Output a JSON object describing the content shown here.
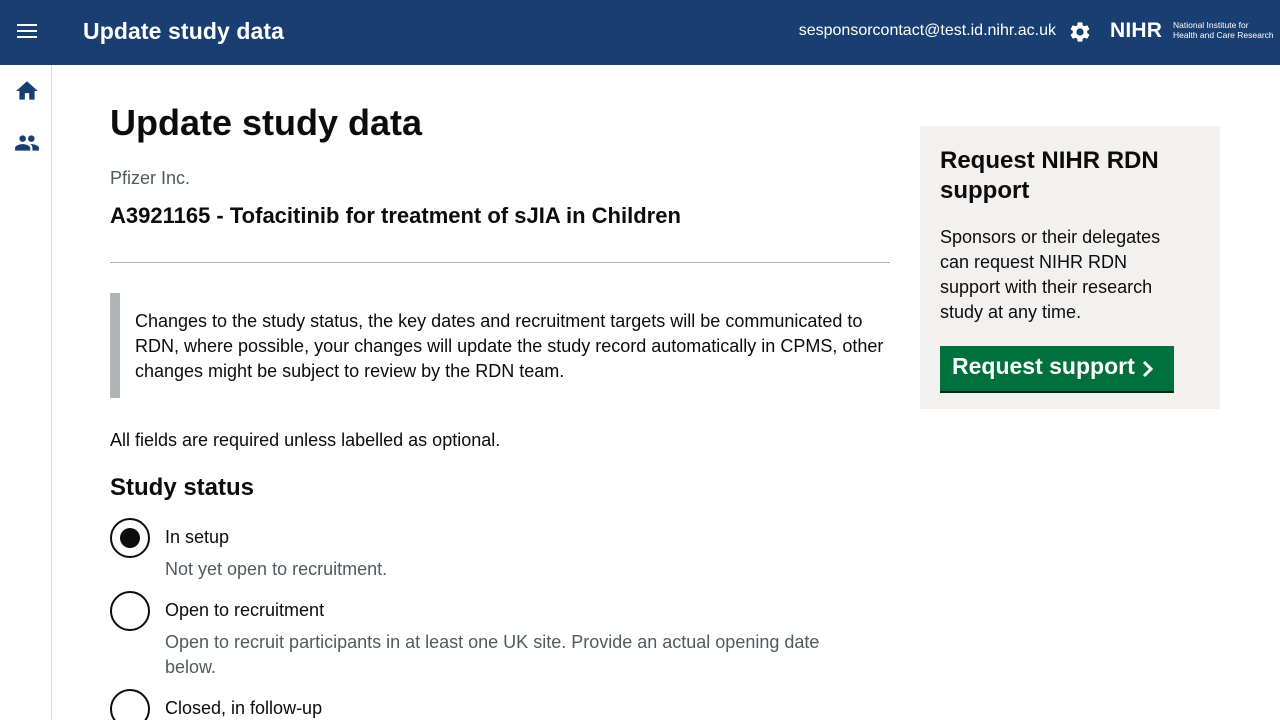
{
  "header": {
    "app_title": "Update study data",
    "user_email": "sesponsorcontact@test.id.nihr.ac.uk",
    "logo_main": "NIHR",
    "logo_sub_line1": "National Institute for",
    "logo_sub_line2": "Health and Care Research",
    "icons": [
      "menu-icon",
      "gear-icon"
    ]
  },
  "siderail": {
    "icons": [
      "home-icon",
      "people-icon"
    ]
  },
  "main": {
    "page_title": "Update study data",
    "organisation": "Pfizer Inc.",
    "study_title": "A3921165 - Tofacitinib for treatment of sJIA in Children",
    "inset_text": "Changes to the study status, the key dates and recruitment targets will be communicated to RDN, where possible, your changes will update the study record automatically in CPMS, other changes might be subject to review by the RDN team.",
    "required_note": "All fields are required unless labelled as optional.",
    "study_status": {
      "heading": "Study status",
      "options": [
        {
          "label": "In setup",
          "hint": "Not yet open to recruitment.",
          "checked": true
        },
        {
          "label": "Open to recruitment",
          "hint": "Open to recruit participants in at least one UK site. Provide an actual opening date below.",
          "checked": false
        },
        {
          "label": "Closed, in follow-up",
          "hint": "",
          "checked": false
        }
      ]
    }
  },
  "panel": {
    "title": "Request NIHR RDN support",
    "text": "Sponsors or their delegates can request NIHR RDN support with their research study at any time.",
    "button_label": "Request support"
  },
  "colors": {
    "header_bg": "#193e72",
    "button_green": "#00703c",
    "panel_bg": "#f2f1ef"
  }
}
